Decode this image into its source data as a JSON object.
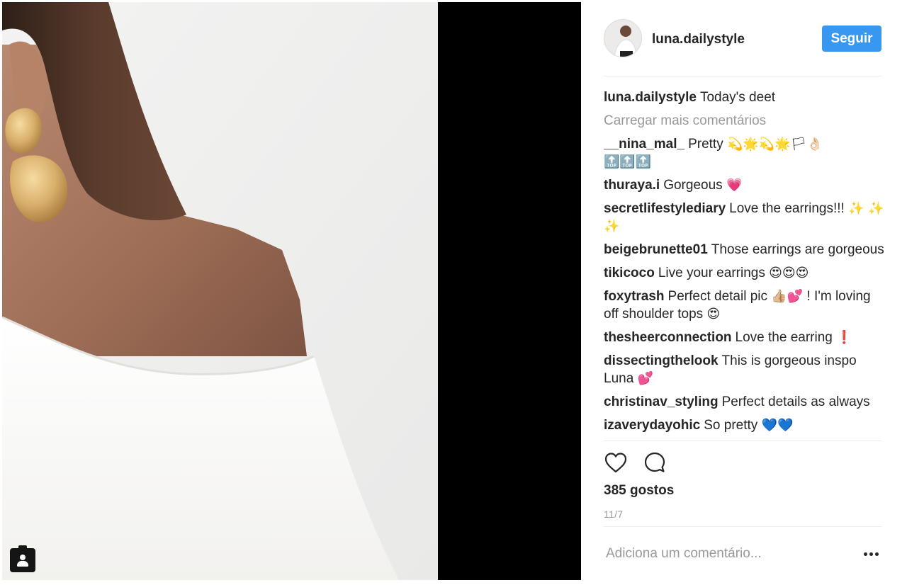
{
  "post": {
    "username": "luna.dailystyle",
    "follow_label": "Seguir",
    "caption_text": "Today's deet",
    "load_more_label": "Carregar mais comentários",
    "likes_label": "385 gostos",
    "date_label": "11/7",
    "comment_placeholder": "Adiciona um comentário..."
  },
  "comments": [
    {
      "user": "__nina_mal_",
      "text": "Pretty",
      "emoji": "💫🌟💫🌟🏳👌🏻",
      "second_line_emoji": "🔝🔝🔝"
    },
    {
      "user": "thuraya.i",
      "text": "Gorgeous",
      "emoji": "💗"
    },
    {
      "user": "secretlifestylediary",
      "text": "Love the earrings!!!",
      "emoji": "✨ ✨ ✨"
    },
    {
      "user": "beigebrunette01",
      "text": "Those earrings are gorgeous",
      "emoji": ""
    },
    {
      "user": "tikicoco",
      "text": "Live your earrings",
      "emoji": "😍😍😍"
    },
    {
      "user": "foxytrash",
      "text": "Perfect detail pic",
      "emoji": "👍🏼💕",
      "text_after": "! I'm loving off shoulder tops",
      "emoji_after": "😍"
    },
    {
      "user": "thesheerconnection",
      "text": "Love the earring",
      "emoji": "❗"
    },
    {
      "user": "dissectingthelook",
      "text": "This is gorgeous inspo Luna",
      "emoji": "💕"
    },
    {
      "user": "christinav_styling",
      "text": "Perfect details as always",
      "emoji": ""
    },
    {
      "user": "izaverydayohic",
      "text": "So pretty",
      "emoji": "💙💙"
    }
  ],
  "icons": {
    "heart": "heart-icon",
    "comment": "comment-icon",
    "more": "more-options-icon",
    "tag_user": "user-tag-icon"
  },
  "colors": {
    "follow_button": "#3897f0",
    "text": "#262626",
    "muted": "#999999",
    "divider": "#efefef",
    "side_black": "#000000"
  }
}
